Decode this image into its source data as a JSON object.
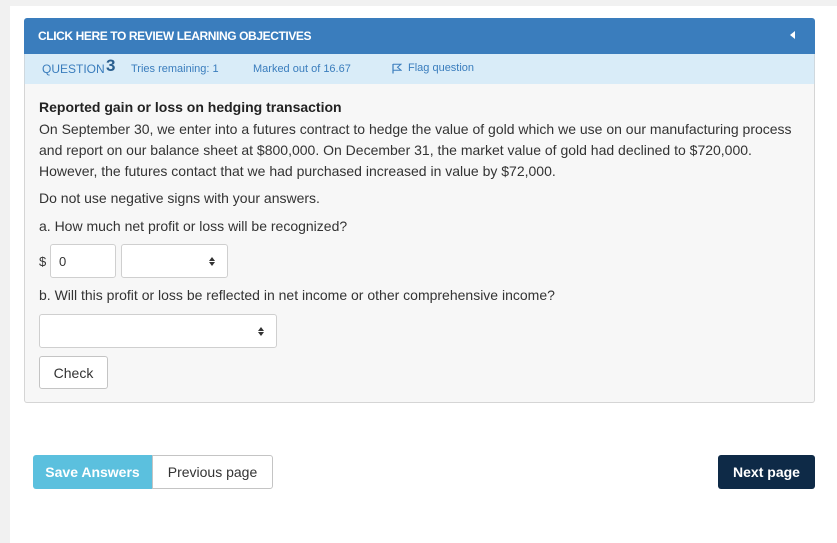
{
  "objectives_bar": {
    "label": "CLICK HERE TO REVIEW LEARNING OBJECTIVES"
  },
  "question_info": {
    "label": "QUESTION",
    "number": "3",
    "tries": "Tries remaining: 1",
    "marked": "Marked out of 16.67",
    "flag": "Flag question"
  },
  "question": {
    "title": "Reported gain or loss on hedging transaction",
    "text": "On September 30, we enter into a futures contract to hedge the value of gold which we use on our manufacturing process and report on our balance sheet at $800,000. On December 31, the market value of gold had declined to $720,000. However, the futures contact that we had purchased increased in value by $72,000.",
    "instruction": "Do not use negative signs with your answers.",
    "part_a": "a. How much net profit or loss will be recognized?",
    "currency": "$",
    "amount_value": "0",
    "profit_loss_selected": "",
    "part_b": "b. Will this profit or loss be reflected in net income or other comprehensive income?",
    "income_type_selected": "",
    "check_label": "Check"
  },
  "footer": {
    "save_label": "Save Answers",
    "previous_label": "Previous page",
    "next_label": "Next page"
  },
  "colors": {
    "objectives_bar": "#3a7dbd",
    "question_bar": "#d9ecf8",
    "save_button": "#5bc0de",
    "next_button": "#0e2a47"
  }
}
